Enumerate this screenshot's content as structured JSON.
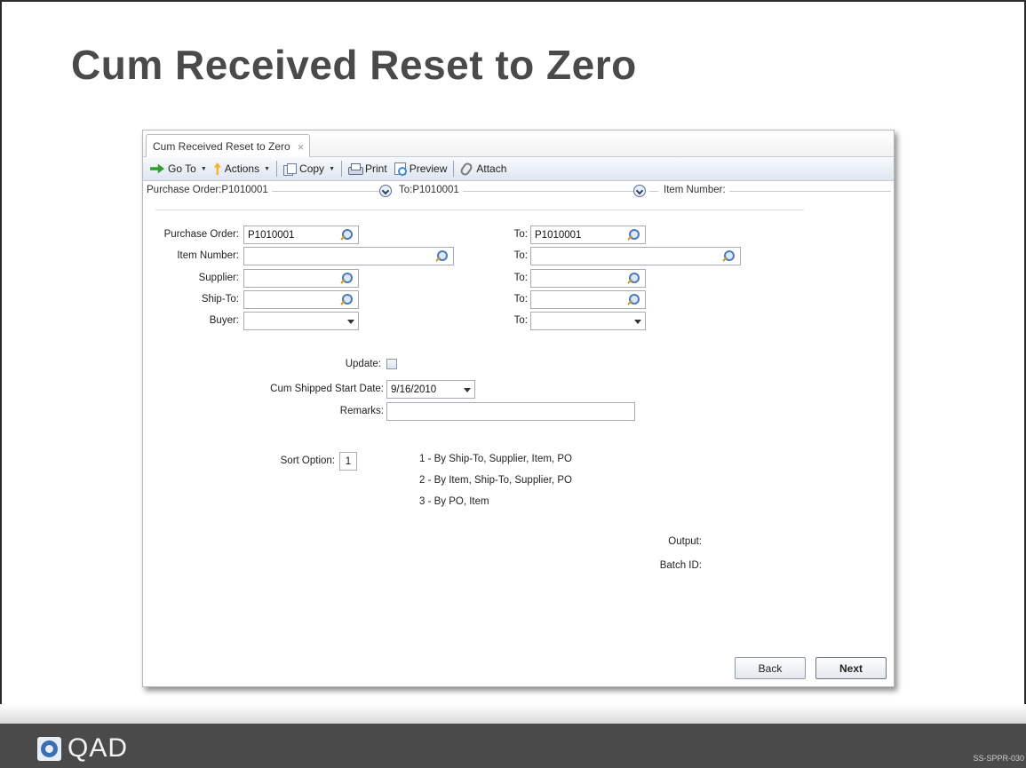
{
  "slide": {
    "title": "Cum Received Reset to Zero",
    "code": "SS-SPPR-030",
    "logo_text": "QAD"
  },
  "window": {
    "tab_label": "Cum Received Reset to Zero",
    "tab_close": "×"
  },
  "toolbar": {
    "goto": "Go To",
    "actions": "Actions",
    "copy": "Copy",
    "print": "Print",
    "preview": "Preview",
    "attach": "Attach"
  },
  "summary": {
    "purchase_order": "Purchase Order:P1010001",
    "to": "To:P1010001",
    "item_number": "Item Number:"
  },
  "range_fields": {
    "purchase_order": {
      "label": "Purchase Order:",
      "from": "P1010001",
      "to_label": "To:",
      "to": "P1010001"
    },
    "item_number": {
      "label": "Item Number:",
      "from": "",
      "to_label": "To:",
      "to": ""
    },
    "supplier": {
      "label": "Supplier:",
      "from": "",
      "to_label": "To:",
      "to": ""
    },
    "ship_to": {
      "label": "Ship-To:",
      "from": "",
      "to_label": "To:",
      "to": ""
    },
    "buyer": {
      "label": "Buyer:",
      "from": "",
      "to_label": "To:",
      "to": ""
    }
  },
  "options": {
    "update_label": "Update:",
    "update_checked": false,
    "cum_shipped_start_date_label": "Cum Shipped Start Date:",
    "cum_shipped_start_date": "9/16/2010",
    "remarks_label": "Remarks:",
    "remarks": "",
    "sort_option_label": "Sort Option:",
    "sort_option": "1",
    "sort_choices": [
      "1 - By Ship-To, Supplier, Item, PO",
      "2 - By Item, Ship-To, Supplier, PO",
      "3 - By PO, Item"
    ]
  },
  "output": {
    "output_label": "Output:",
    "batch_id_label": "Batch ID:"
  },
  "buttons": {
    "back": "Back",
    "next": "Next"
  }
}
